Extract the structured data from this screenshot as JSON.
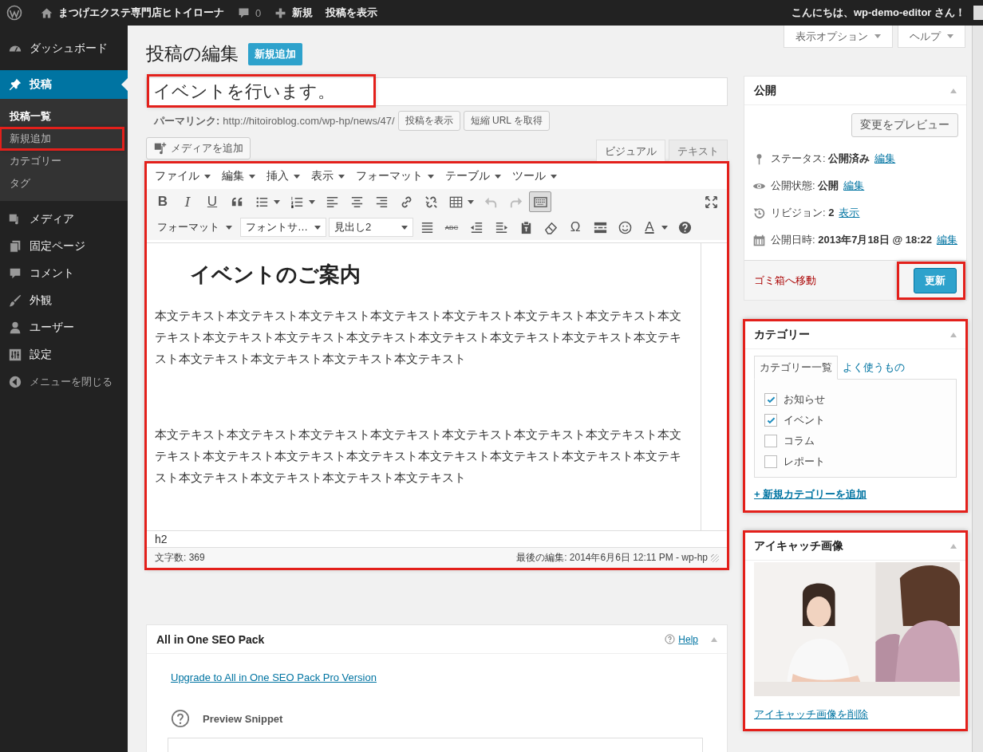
{
  "admin_bar": {
    "site_name": "まつげエクステ専門店ヒトイローナ",
    "comments_count": "0",
    "new_label": "新規",
    "view_post": "投稿を表示",
    "greeting": "こんにちは、wp-demo-editor さん！"
  },
  "sidebar": {
    "items": [
      {
        "label": "ダッシュボード",
        "selected": false
      },
      {
        "label": "投稿",
        "selected": true,
        "children": [
          {
            "label": "投稿一覧",
            "selected": true,
            "highlighted": false
          },
          {
            "label": "新規追加",
            "selected": false,
            "highlighted": true
          },
          {
            "label": "カテゴリー",
            "selected": false,
            "highlighted": false
          },
          {
            "label": "タグ",
            "selected": false,
            "highlighted": false
          }
        ]
      },
      {
        "label": "メディア",
        "selected": false
      },
      {
        "label": "固定ページ",
        "selected": false
      },
      {
        "label": "コメント",
        "selected": false
      },
      {
        "label": "外観",
        "selected": false
      },
      {
        "label": "ユーザー",
        "selected": false
      },
      {
        "label": "設定",
        "selected": false
      }
    ],
    "collapse_label": "メニューを閉じる"
  },
  "screen_tabs": [
    "表示オプション",
    "ヘルプ"
  ],
  "page_title": "投稿の編集",
  "add_new": "新規追加",
  "post_title": {
    "value": "イベントを行います。",
    "highlighted": true
  },
  "permalink": {
    "label": "パーマリンク:",
    "url": "http://hitoiroblog.com/wp-hp/news/47/",
    "buttons": [
      "投稿を表示",
      "短縮 URL を取得"
    ]
  },
  "add_media": "メディアを追加",
  "editor_tabs": [
    {
      "label": "ビジュアル",
      "selected": true
    },
    {
      "label": "テキスト",
      "selected": false
    }
  ],
  "editor": {
    "highlighted": true,
    "menus": [
      "ファイル",
      "編集",
      "挿入",
      "表示",
      "フォーマット",
      "テーブル",
      "ツール"
    ],
    "toolbar_row_1": [
      {
        "kind": "glyph",
        "label": "B"
      },
      {
        "kind": "glyph",
        "label": "I"
      },
      {
        "kind": "glyph",
        "label": "U"
      },
      {
        "kind": "icon"
      },
      {
        "kind": "icon"
      },
      {
        "kind": "icon"
      },
      {
        "kind": "icon"
      },
      {
        "kind": "icon"
      },
      {
        "kind": "icon"
      },
      {
        "kind": "icon"
      },
      {
        "kind": "icon"
      },
      {
        "kind": "icon"
      },
      {
        "kind": "icon",
        "disabled": true
      },
      {
        "kind": "icon",
        "disabled": true
      },
      {
        "kind": "icon",
        "active": true
      }
    ],
    "toolbar_row_2": [
      {
        "kind": "select",
        "label": "フォーマット"
      },
      {
        "kind": "select",
        "label": "フォントサ…"
      },
      {
        "kind": "select",
        "label": "見出し2"
      },
      {
        "kind": "icon"
      },
      {
        "kind": "glyph",
        "label": "ABC"
      },
      {
        "kind": "icon"
      },
      {
        "kind": "icon"
      },
      {
        "kind": "icon"
      },
      {
        "kind": "icon"
      },
      {
        "kind": "glyph",
        "label": "Ω"
      },
      {
        "kind": "icon"
      },
      {
        "kind": "icon"
      },
      {
        "kind": "glyph",
        "label": "A"
      },
      {
        "kind": "icon"
      }
    ],
    "heading": "イベントのご案内",
    "paragraphs": [
      "本文テキスト本文テキスト本文テキスト本文テキスト本文テキスト本文テキスト本文テキスト本文テキスト本文テキスト本文テキスト本文テキスト本文テキスト本文テキスト本文テキスト本文テキスト本文テキスト本文テキスト本文テキスト本文テキスト",
      "本文テキスト本文テキスト本文テキスト本文テキスト本文テキスト本文テキスト本文テキスト本文テキスト本文テキスト本文テキスト本文テキスト本文テキスト本文テキスト本文テキスト本文テキスト本文テキスト本文テキスト本文テキスト本文テキスト"
    ],
    "path": "h2",
    "word_count": "文字数: 369",
    "last_edit": "最後の編集: 2014年6月6日 12:11 PM - wp-hp"
  },
  "seo_box": {
    "title": "All in One SEO Pack",
    "help": "Help",
    "upgrade_link": "Upgrade to All in One SEO Pack Pro Version",
    "preview_label": "Preview Snippet"
  },
  "publish_box": {
    "title": "公開",
    "preview_button": "変更をプレビュー",
    "rows": [
      {
        "label": "ステータス:",
        "value": "公開済み",
        "link": "編集"
      },
      {
        "label": "公開状態:",
        "value": "公開",
        "link": "編集"
      },
      {
        "label": "リビジョン:",
        "value": "2",
        "link": "表示"
      },
      {
        "label": "公開日時:",
        "value": "2013年7月18日 @ 18:22",
        "link": "編集"
      }
    ],
    "trash": "ゴミ箱へ移動",
    "update": "更新",
    "update_highlighted": true
  },
  "category_box": {
    "title": "カテゴリー",
    "highlighted": true,
    "tabs": [
      {
        "label": "カテゴリー一覧",
        "selected": true
      },
      {
        "label": "よく使うもの",
        "selected": false
      }
    ],
    "categories": [
      {
        "label": "お知らせ",
        "checked": true
      },
      {
        "label": "イベント",
        "checked": true
      },
      {
        "label": "コラム",
        "checked": false
      },
      {
        "label": "レポート",
        "checked": false
      }
    ],
    "add_link": "+ 新規カテゴリーを追加"
  },
  "featured_box": {
    "title": "アイキャッチ画像",
    "highlighted": true,
    "remove_link": "アイキャッチ画像を削除"
  }
}
